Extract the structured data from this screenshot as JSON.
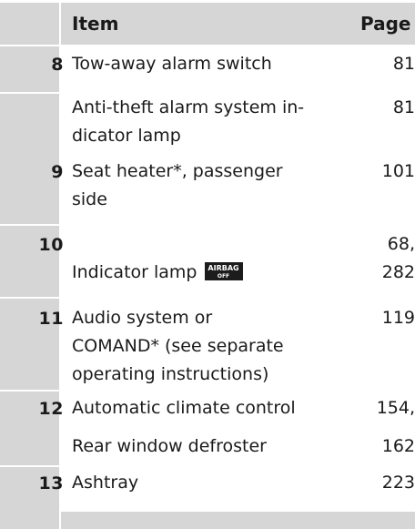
{
  "header": {
    "item": "Item",
    "page": "Page"
  },
  "rows": [
    {
      "num": "8",
      "item": "Tow-away alarm switch",
      "page": "81"
    },
    {
      "num": "",
      "item": "Anti-theft alarm system in-\ndicator lamp",
      "page": "81"
    },
    {
      "num": "9",
      "item": "Seat heater*, passenger\nside",
      "page": "101"
    },
    {
      "num": "10",
      "item": "Indicator lamp",
      "page": "68,\n282",
      "icon": "airbag-off-indicator-icon",
      "icon_text_top": "AIRBAG",
      "icon_text_bottom": "OFF"
    },
    {
      "num": "11",
      "item": "Audio system or\nCOMAND* (see separate\noperating instructions)",
      "page": "119"
    },
    {
      "num": "12",
      "item": "Automatic climate control",
      "page": "154,"
    },
    {
      "num": "",
      "item": "Rear window defroster",
      "page": "162"
    },
    {
      "num": "13",
      "item": "Ashtray",
      "page": "223"
    }
  ],
  "colors": {
    "header_bg": "#d6d6d6",
    "separator": "#ffffff",
    "text": "#1a1a1a",
    "icon_bg": "#1c1c1c"
  }
}
